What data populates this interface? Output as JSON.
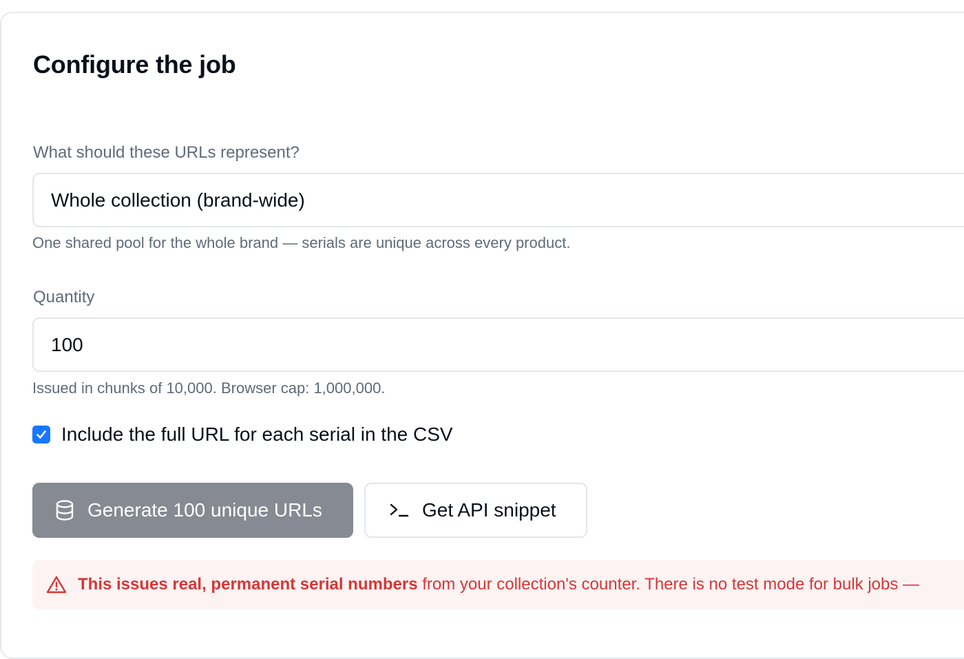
{
  "card": {
    "title": "Configure the job"
  },
  "represent": {
    "label": "What should these URLs represent?",
    "value": "Whole collection (brand-wide)",
    "hint": "One shared pool for the whole brand — serials are unique across every product."
  },
  "quantity": {
    "label": "Quantity",
    "value": "100",
    "hint": "Issued in chunks of 10,000. Browser cap: 1,000,000."
  },
  "include_url": {
    "label": "Include the full URL for each serial in the CSV",
    "checked": true
  },
  "actions": {
    "generate_label": "Generate 100 unique URLs",
    "generate_icon": "database-icon",
    "api_label": "Get API snippet",
    "api_icon": "terminal-icon"
  },
  "warning": {
    "icon": "warning-triangle-icon",
    "bold_text": "This issues real, permanent serial numbers",
    "text": " from your collection's counter. There is no test mode for bulk jobs —"
  },
  "colors": {
    "accent": "#1677ff",
    "primary_button_bg": "#858a93",
    "warning_text": "#d63636",
    "warning_bg": "#fef3f3"
  }
}
